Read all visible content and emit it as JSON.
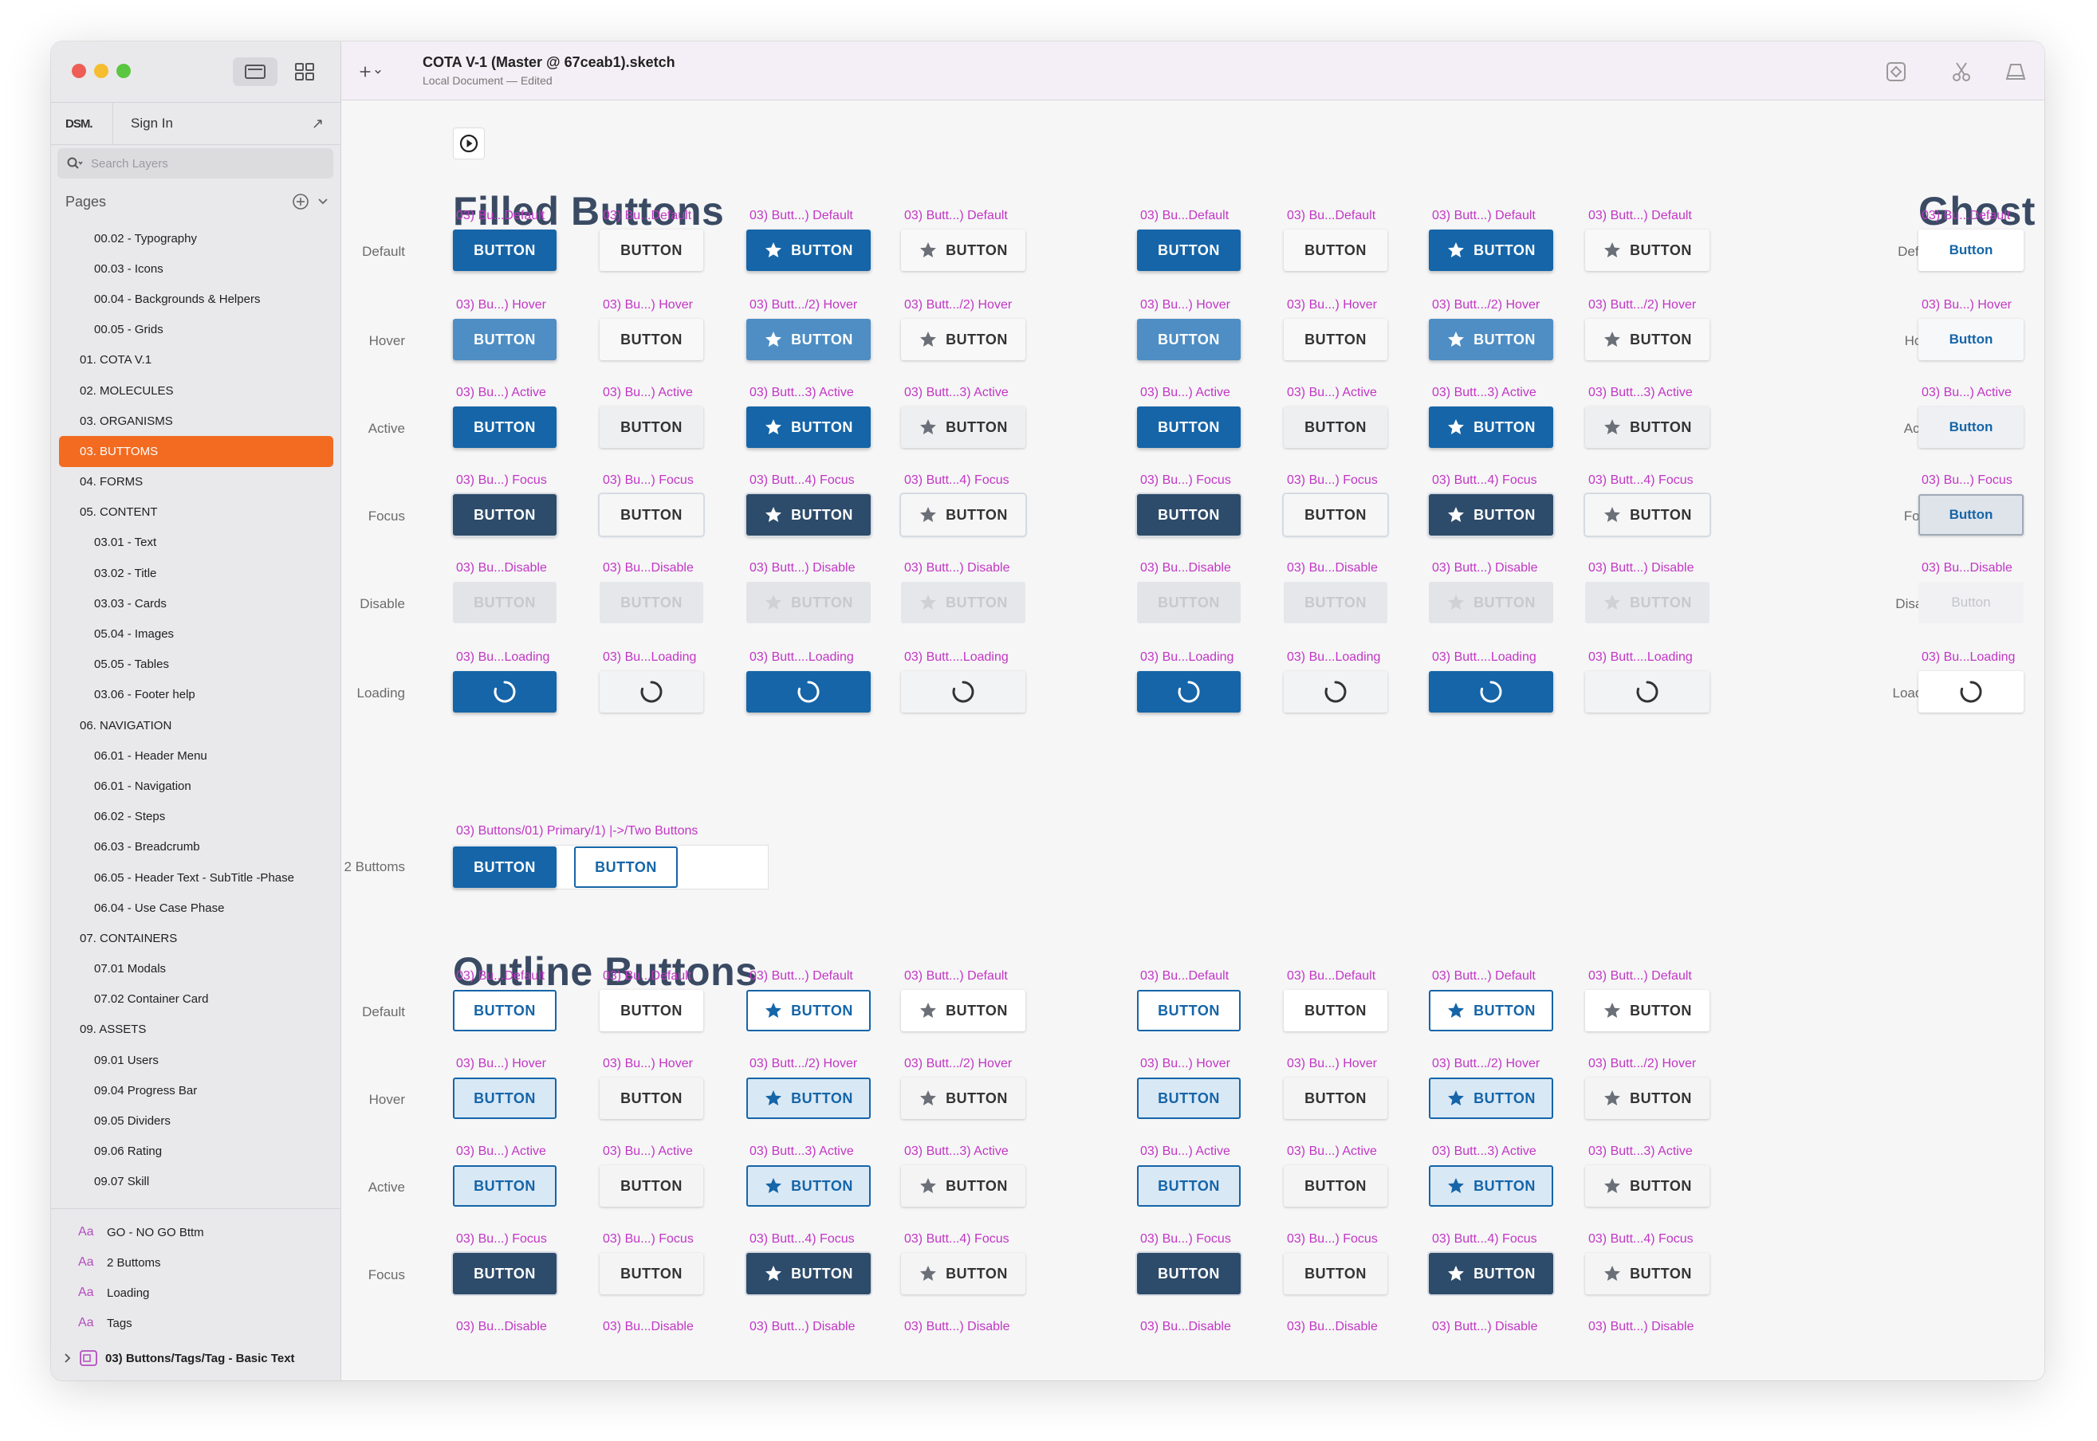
{
  "window": {
    "title": "COTA V-1 (Master @ 67ceab1).sketch",
    "subtitle": "Local Document — Edited"
  },
  "sidebar": {
    "tab_dsm": "DSM.",
    "tab_signin": "Sign In",
    "search_placeholder": "Search Layers",
    "pages_header": "Pages",
    "pages": [
      {
        "label": "00.02 - Typography",
        "level": 2
      },
      {
        "label": "00.03 - Icons",
        "level": 2
      },
      {
        "label": "00.04 - Backgrounds & Helpers",
        "level": 2
      },
      {
        "label": "00.05 - Grids",
        "level": 2
      },
      {
        "label": "01. COTA V.1",
        "level": 1
      },
      {
        "label": "02. MOLECULES",
        "level": 1
      },
      {
        "label": "03. ORGANISMS",
        "level": 1
      },
      {
        "label": "03. BUTTOMS",
        "level": 1,
        "selected": true
      },
      {
        "label": "04. FORMS",
        "level": 1
      },
      {
        "label": "05. CONTENT",
        "level": 1
      },
      {
        "label": "03.01 - Text",
        "level": 2
      },
      {
        "label": "03.02 - Title",
        "level": 2
      },
      {
        "label": "03.03 - Cards",
        "level": 2
      },
      {
        "label": "05.04 - Images",
        "level": 2
      },
      {
        "label": "05.05 - Tables",
        "level": 2
      },
      {
        "label": "03.06 - Footer help",
        "level": 2
      },
      {
        "label": "06. NAVIGATION",
        "level": 1
      },
      {
        "label": "06.01 - Header Menu",
        "level": 2
      },
      {
        "label": "06.01 - Navigation",
        "level": 2
      },
      {
        "label": "06.02 - Steps",
        "level": 2
      },
      {
        "label": "06.03 - Breadcrumb",
        "level": 2
      },
      {
        "label": "06.05 - Header Text - SubTitle -Phase",
        "level": 2
      },
      {
        "label": "06.04 - Use Case Phase",
        "level": 2
      },
      {
        "label": "07. CONTAINERS",
        "level": 1
      },
      {
        "label": "07.01 Modals",
        "level": 2
      },
      {
        "label": "07.02 Container Card",
        "level": 2
      },
      {
        "label": "09. ASSETS",
        "level": 1
      },
      {
        "label": "09.01 Users",
        "level": 2
      },
      {
        "label": "09.04 Progress Bar",
        "level": 2
      },
      {
        "label": "09.05 Dividers",
        "level": 2
      },
      {
        "label": "09.06 Rating",
        "level": 2
      },
      {
        "label": "09.07 Skill",
        "level": 2
      }
    ],
    "symbols": [
      {
        "icon": "Aa",
        "label": "GO - NO GO Bttm"
      },
      {
        "icon": "Aa",
        "label": "2 Buttoms"
      },
      {
        "icon": "Aa",
        "label": "Loading"
      },
      {
        "icon": "Aa",
        "label": "Tags"
      }
    ],
    "bottom_item": "03) Buttons/Tags/Tag - Basic Text"
  },
  "canvas": {
    "filled_title": "Filled Buttons",
    "outline_title": "Outline Buttons",
    "ghost_title": "Ghost",
    "row_labels": [
      "Default",
      "Hover",
      "Active",
      "Focus",
      "Disable",
      "Loading"
    ],
    "two_buttons_label": "2 Buttoms",
    "button_label": "BUTTON",
    "ghost_button_label": "Button",
    "captions": {
      "primary": [
        "03) Bu...Default",
        "03) Bu...) Hover",
        "03) Bu...) Active",
        "03) Bu...) Focus",
        "03) Bu...Disable",
        "03) Bu...Loading"
      ],
      "secondary": [
        "03) Bu...Default",
        "03) Bu...) Hover",
        "03) Bu...) Active",
        "03) Bu...) Focus",
        "03) Bu...Disable",
        "03) Bu...Loading"
      ],
      "icon_primary": [
        "03) Butt...) Default",
        "03) Butt.../2) Hover",
        "03) Butt...3) Active",
        "03) Butt...4) Focus",
        "03) Butt...) Disable",
        "03) Butt....Loading"
      ],
      "icon_secondary": [
        "03) Butt...) Default",
        "03) Butt.../2) Hover",
        "03) Butt...3) Active",
        "03) Butt...4) Focus",
        "03) Butt...) Disable",
        "03) Butt....Loading"
      ],
      "ghost": [
        "03) Bu...Default",
        "03) Bu...) Hover",
        "03) Bu...) Active",
        "03) Bu...) Focus",
        "03) Bu...Disable",
        "03) Bu...Loading"
      ],
      "two_buttons": "03) Buttons/01) Primary/1) |->/Two Buttons"
    }
  },
  "colors": {
    "primary": "#1565a8",
    "primary_hover": "#4e8ec4",
    "primary_focus": "#2d4b6a",
    "caption": "#c236c4",
    "selected_page": "#f26b21",
    "heading": "#3a4a63"
  }
}
